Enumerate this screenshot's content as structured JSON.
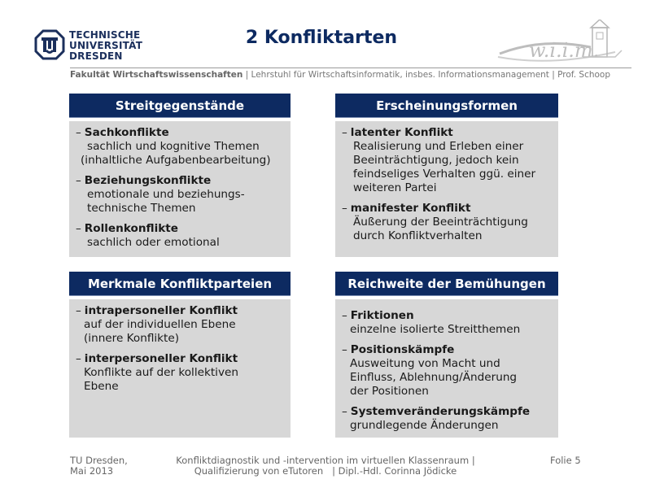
{
  "header": {
    "logo_lines": [
      "TECHNISCHE",
      "UNIVERSITÄT",
      "DRESDEN"
    ],
    "title": "2 Konfliktarten",
    "brand_logo": "wiim-logo",
    "faculty": "Fakultät Wirtschaftswissenschaften",
    "chair": " | Lehrstuhl für Wirtschaftsinformatik, insbes. Informationsmanagement | Prof. Schoop"
  },
  "boxes": {
    "streitgegenstaende": {
      "heading": "Streitgegenstände",
      "items": [
        {
          "dash": "–",
          "title": "Sachkonflikte",
          "desc": [
            "sachlich und kognitive Themen",
            "(inhaltliche Aufgabenbearbeitung)"
          ]
        },
        {
          "dash": "–",
          "title": "Beziehungskonflikte",
          "desc": [
            "emotionale und beziehungs-",
            "technische Themen"
          ]
        },
        {
          "dash": "–",
          "title": "Rollenkonflikte",
          "desc": [
            "sachlich oder emotional"
          ]
        }
      ]
    },
    "erscheinungsformen": {
      "heading": "Erscheinungsformen",
      "items": [
        {
          "dash": "–",
          "title": "latenter Konflikt",
          "desc": [
            "Realisierung und Erleben einer",
            "Beeinträchtigung, jedoch kein",
            "feindseliges Verhalten ggü. einer",
            "weiteren Partei"
          ]
        },
        {
          "dash": "–",
          "title": "manifester Konflikt",
          "desc": [
            "Äußerung der Beeinträchtigung",
            "durch Konfliktverhalten"
          ]
        }
      ]
    },
    "merkmale": {
      "heading": "Merkmale Konfliktparteien",
      "items": [
        {
          "dash": "–",
          "title": "intrapersoneller Konflikt",
          "desc": [
            " auf der individuellen Ebene",
            "(innere Konflikte)"
          ]
        },
        {
          "dash": "–",
          "title": "interpersoneller Konflikt",
          "desc": [
            "Konflikte auf der kollektiven",
            "Ebene"
          ]
        }
      ]
    },
    "reichweite": {
      "heading": "Reichweite der Bemühungen",
      "items": [
        {
          "dash": "–",
          "title": "Friktionen",
          "desc": [
            "einzelne isolierte Streitthemen"
          ]
        },
        {
          "dash": "–",
          "title": "Positionskämpfe",
          "desc": [
            "Ausweitung von Macht und",
            "Einfluss, Ablehnung/Änderung",
            "der Positionen"
          ]
        },
        {
          "dash": "–",
          "title": "Systemveränderungskämpfe",
          "desc": [
            "grundlegende Änderungen"
          ]
        }
      ]
    }
  },
  "footer": {
    "left": [
      "TU Dresden,",
      "Mai 2013"
    ],
    "center": [
      "Konfliktdiagnostik und -intervention im virtuellen Klassenraum |",
      "Qualifizierung von eTutoren   | Dipl.-Hdl. Corinna Jödicke"
    ],
    "right": "Folie 5"
  }
}
